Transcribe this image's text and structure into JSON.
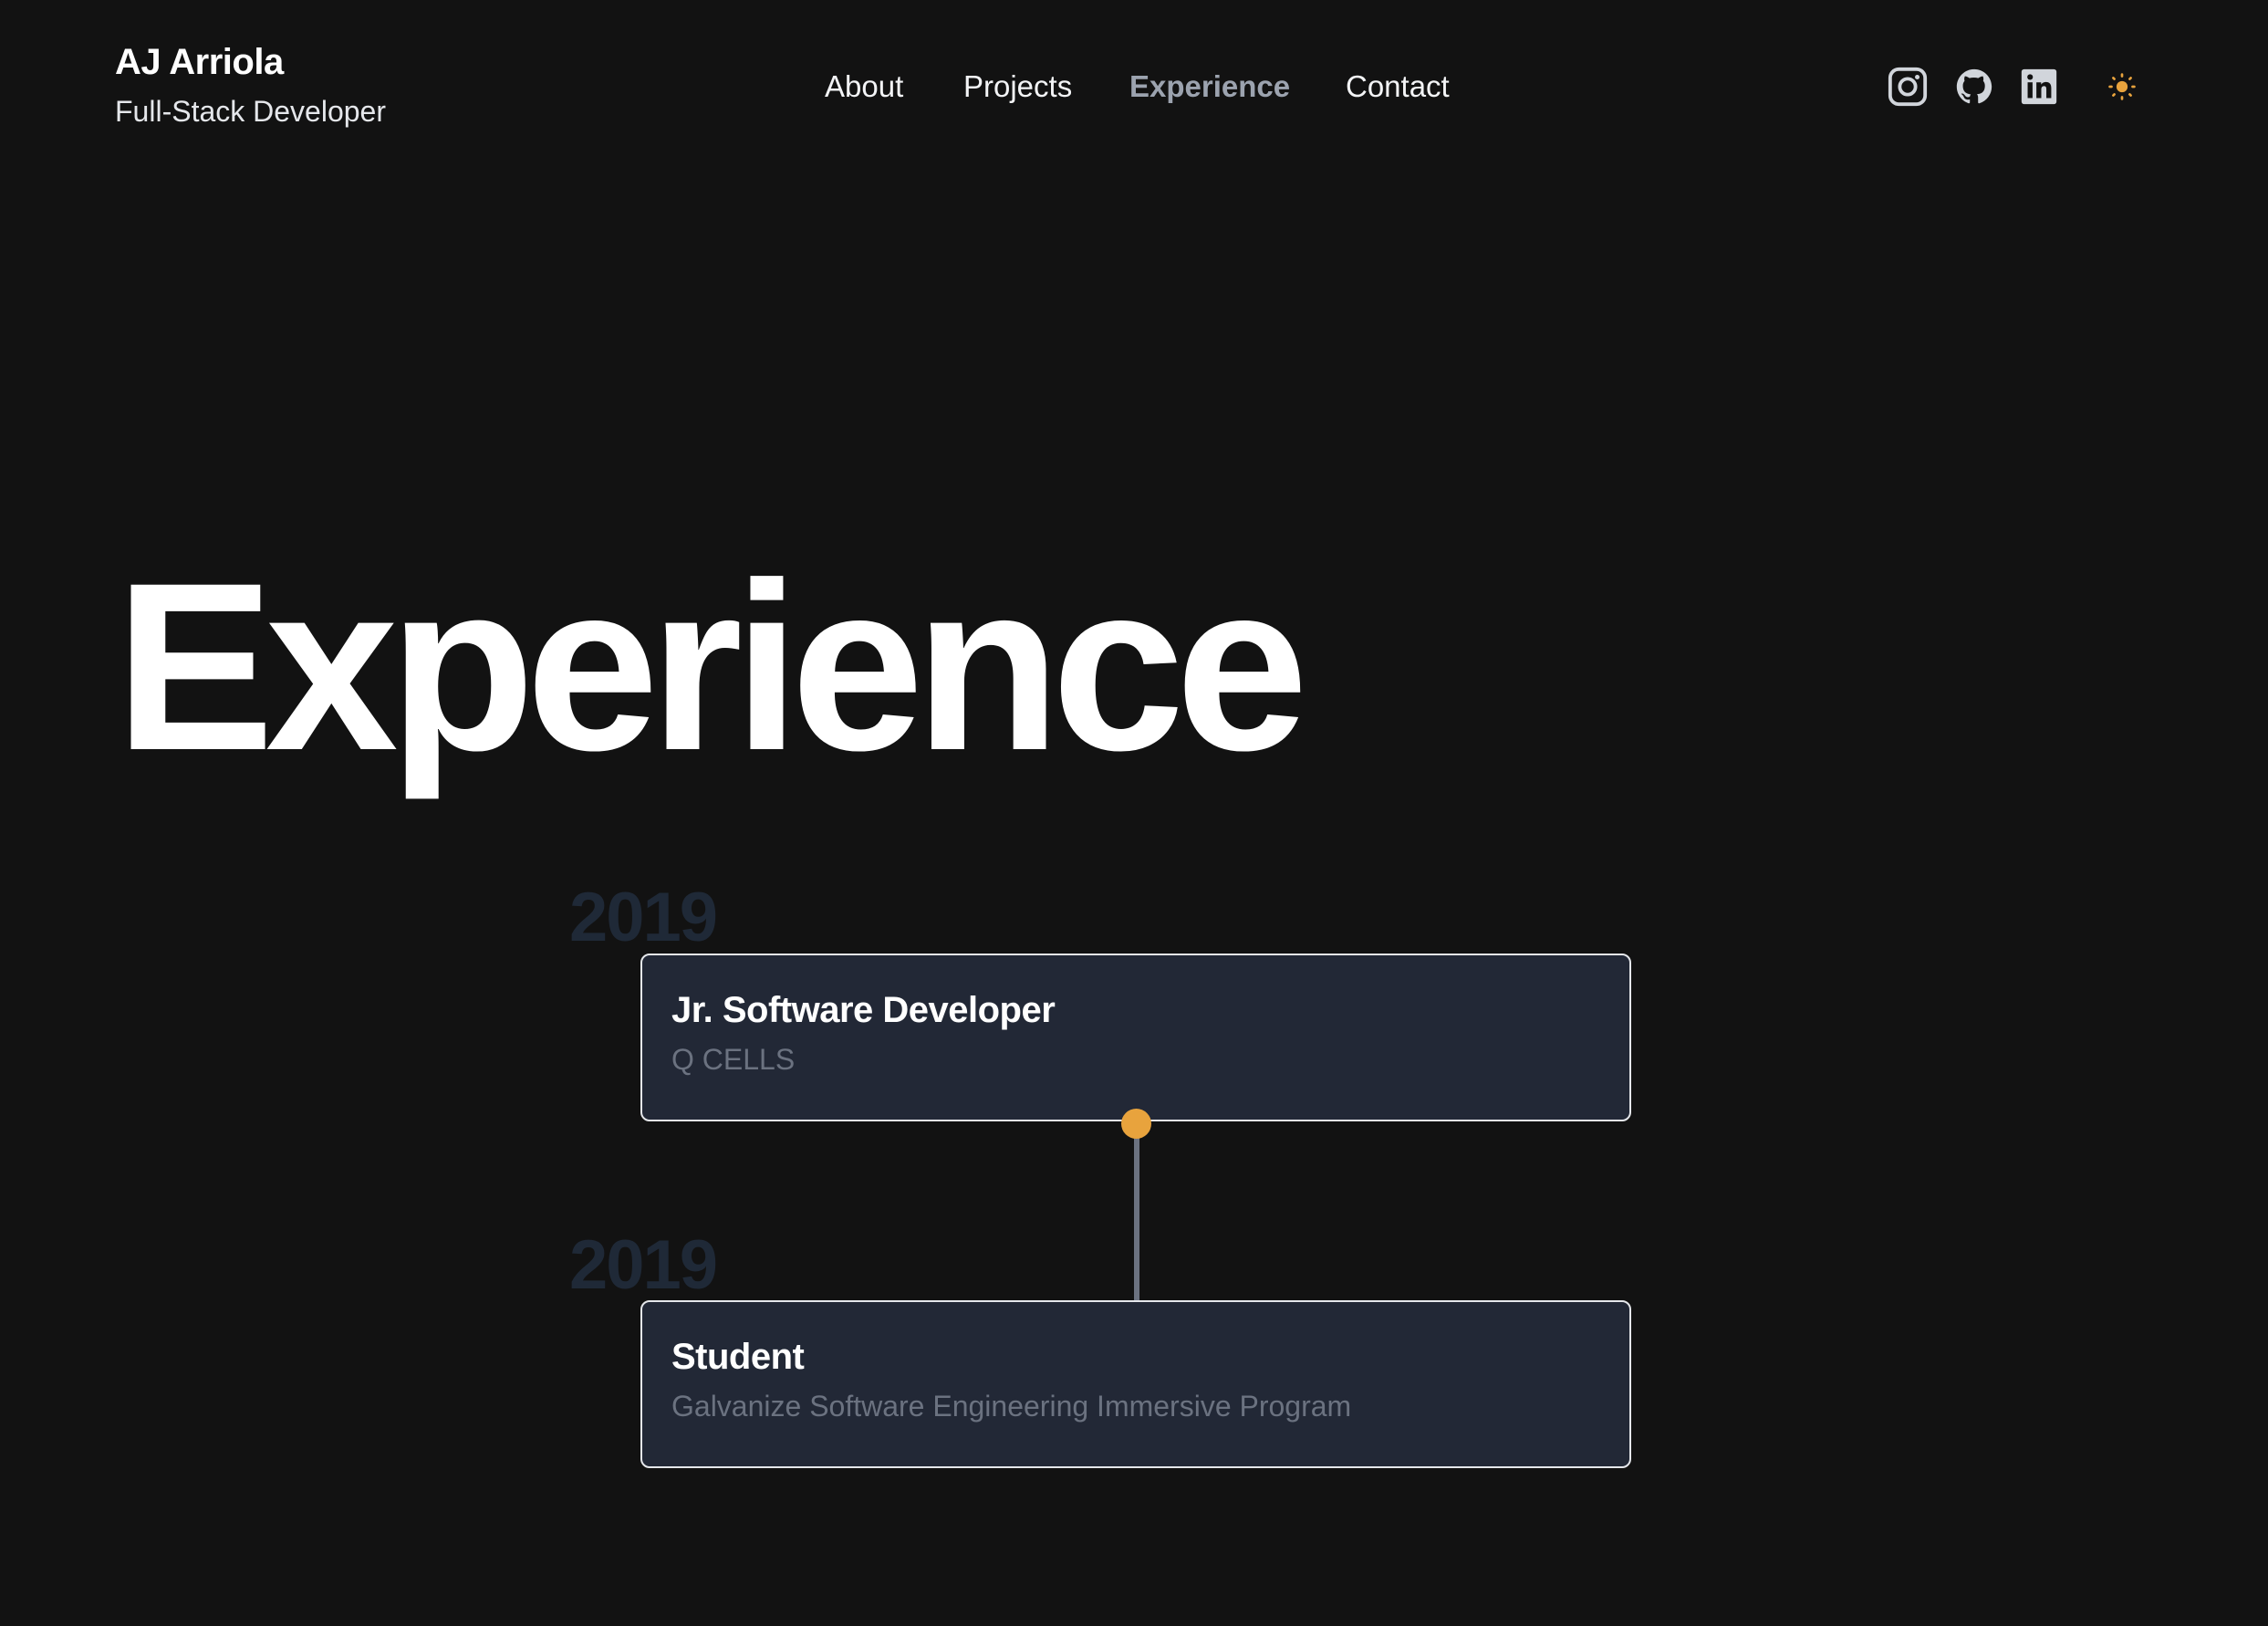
{
  "header": {
    "name": "AJ Arriola",
    "tagline": "Full-Stack Developer",
    "nav": [
      {
        "label": "About",
        "active": false
      },
      {
        "label": "Projects",
        "active": false
      },
      {
        "label": "Experience",
        "active": true
      },
      {
        "label": "Contact",
        "active": false
      }
    ],
    "icons": [
      "instagram-icon",
      "github-icon",
      "linkedin-icon",
      "sun-icon"
    ]
  },
  "page": {
    "title": "Experience"
  },
  "timeline": [
    {
      "year": "2019",
      "title": "Jr. Software Developer",
      "org": "Q CELLS"
    },
    {
      "year": "2019",
      "title": "Student",
      "org": "Galvanize Software Engineering Immersive Program"
    }
  ],
  "colors": {
    "background": "#121212",
    "card": "#222836",
    "accent": "#e8a33d",
    "muted": "#6b7280",
    "year": "#1f2937"
  }
}
